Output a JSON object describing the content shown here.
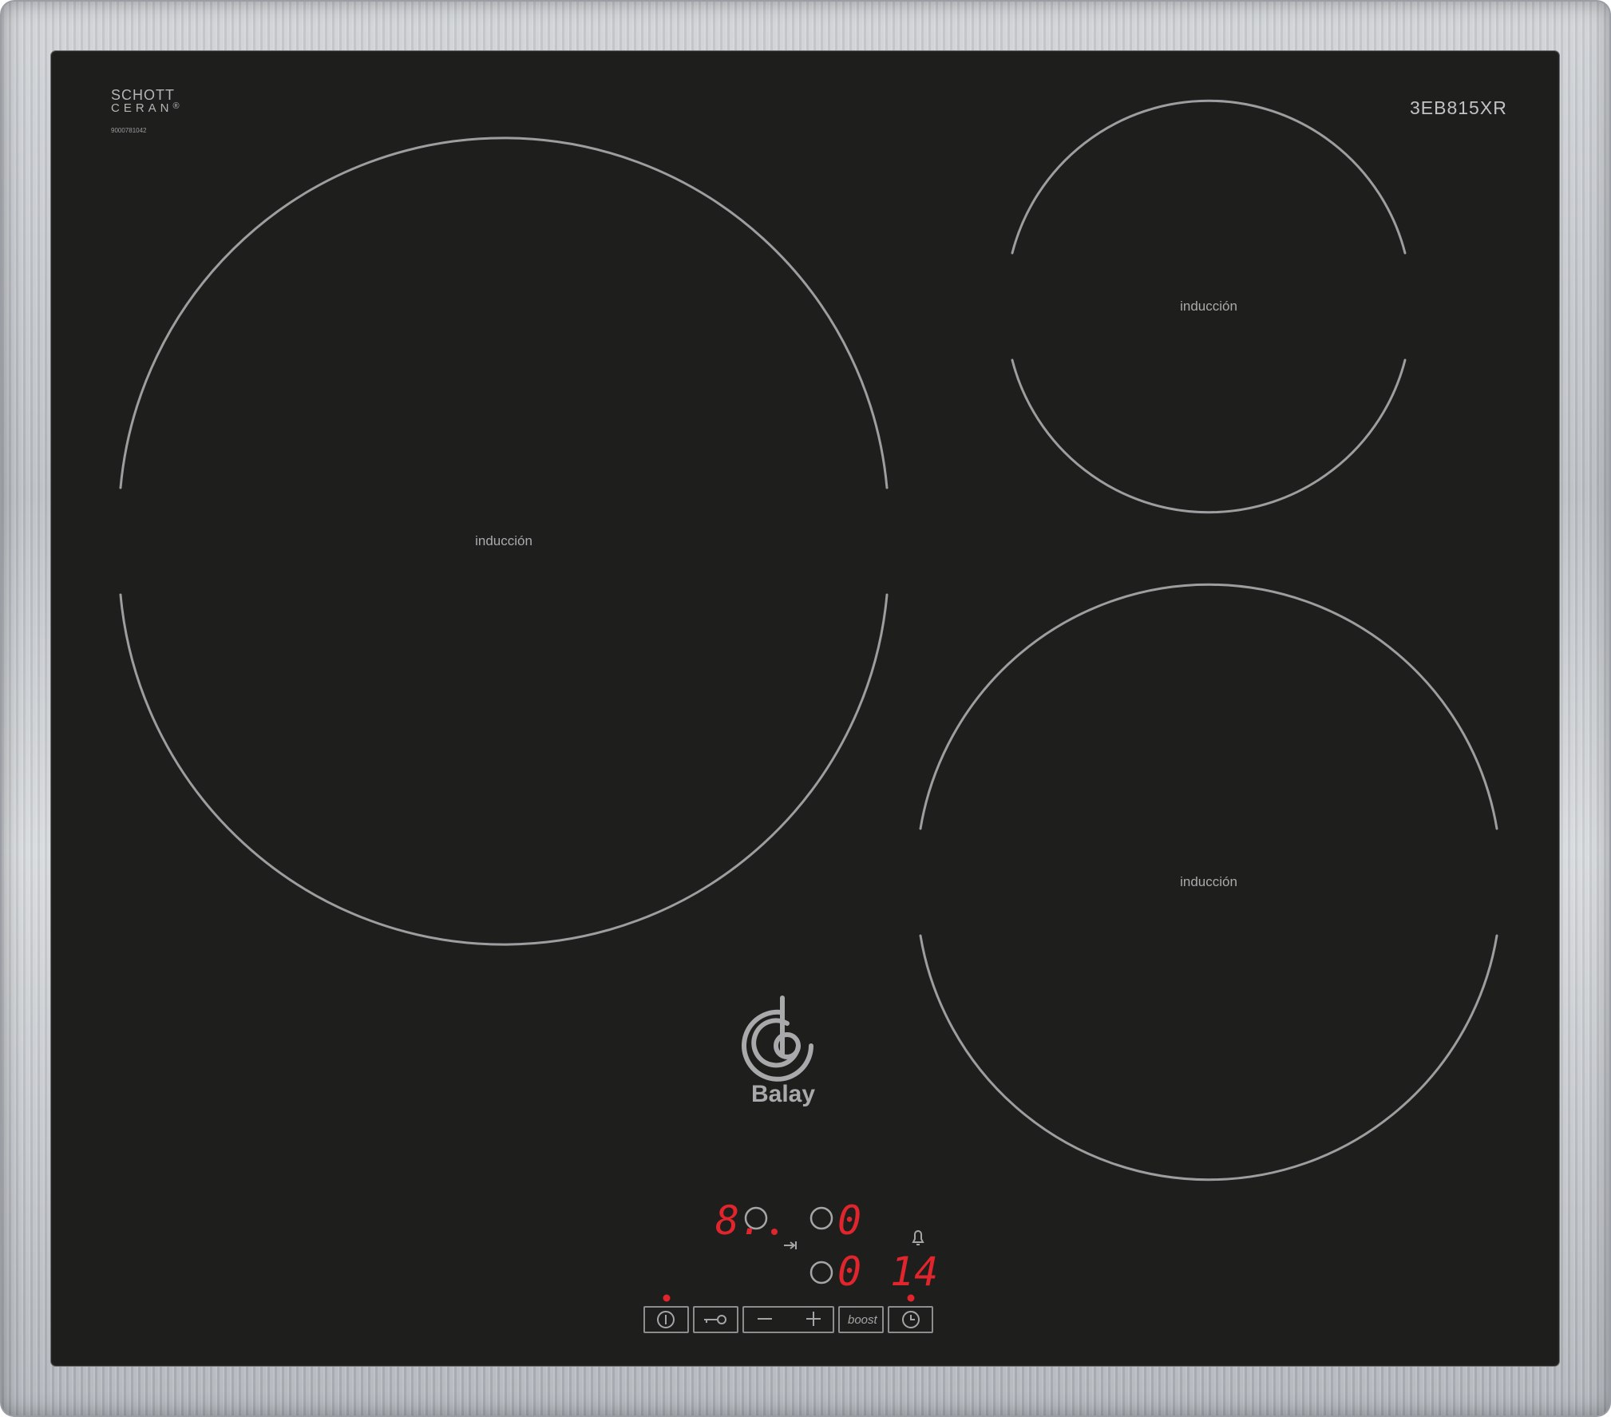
{
  "hob": {
    "maker_mark": {
      "line1": "SCHOTT",
      "line2": "CERAN",
      "symbol": "®"
    },
    "serial_number": "9000781042",
    "model": "3EB815XR",
    "brand": "Balay",
    "brand_icon": "balay-spiral-logo"
  },
  "zones": [
    {
      "id": "large-left",
      "label": "inducción"
    },
    {
      "id": "small-top-right",
      "label": "inducción"
    },
    {
      "id": "medium-bottom-right",
      "label": "inducción"
    }
  ],
  "display": {
    "zone_select_value": "8.",
    "power_level_top": "0",
    "power_level_bottom": "0",
    "timer_value": "14",
    "led_color": "#e0252d"
  },
  "controls": {
    "power_icon": "power-icon",
    "lock_icon": "key-lock-icon",
    "minus_icon": "minus-icon",
    "plus_icon": "plus-icon",
    "boost_label": "boost",
    "timer_icon": "clock-icon",
    "alarm_icon": "bell-icon",
    "pin_icon": "pin-arrow-icon"
  }
}
